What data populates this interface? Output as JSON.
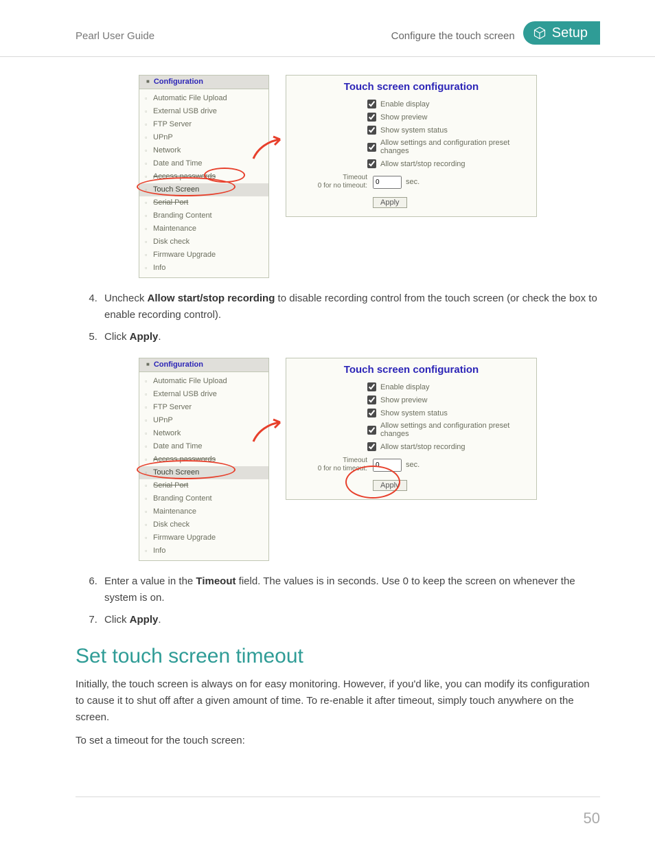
{
  "header": {
    "guide_title": "Pearl User Guide",
    "page_topic": "Configure the touch screen",
    "tab_label": "Setup"
  },
  "sidebar": {
    "title": "Configuration",
    "items": [
      {
        "label": "Automatic File Upload"
      },
      {
        "label": "External USB drive"
      },
      {
        "label": "FTP Server"
      },
      {
        "label": "UPnP"
      },
      {
        "label": "Network"
      },
      {
        "label": "Date and Time"
      },
      {
        "label": "Access passwords",
        "strike": true
      },
      {
        "label": "Touch Screen",
        "highlight": true
      },
      {
        "label": "Serial Port",
        "strike": true
      },
      {
        "label": "Branding Content"
      },
      {
        "label": "Maintenance"
      },
      {
        "label": "Disk check"
      },
      {
        "label": "Firmware Upgrade"
      },
      {
        "label": "Info"
      }
    ]
  },
  "panel": {
    "title": "Touch screen configuration",
    "checks": [
      {
        "label": "Enable display",
        "checked": true
      },
      {
        "label": "Show preview",
        "checked": true
      },
      {
        "label": "Show system status",
        "checked": true
      },
      {
        "label": "Allow settings and configuration preset changes",
        "checked": true
      },
      {
        "label": "Allow start/stop recording",
        "checked": true
      }
    ],
    "timeout_label_l1": "Timeout",
    "timeout_label_l2": "0 for no timeout:",
    "timeout_value": "0",
    "timeout_unit": "sec.",
    "apply_label": "Apply"
  },
  "steps_a": {
    "start": 4,
    "items": [
      {
        "pre": "Uncheck ",
        "bold": "Allow start/stop recording",
        "post": " to disable recording control from the touch screen (or check the box to enable recording control)."
      },
      {
        "pre": "Click ",
        "bold": "Apply",
        "post": "."
      }
    ]
  },
  "steps_b": {
    "start": 6,
    "items": [
      {
        "pre": "Enter a value in the ",
        "bold": "Timeout",
        "post": " field. The values is in seconds.  Use 0 to keep the screen on whenever the system is on."
      },
      {
        "pre": "Click ",
        "bold": "Apply",
        "post": "."
      }
    ]
  },
  "section_heading": "Set touch screen timeout",
  "body_p1": "Initially, the touch screen is always on for easy monitoring. However, if you'd like, you can modify its configuration to cause it to shut off after a given amount of time. To re-enable it after timeout, simply touch anywhere on the screen.",
  "body_p2": "To set a timeout for the touch screen:",
  "page_number": "50",
  "annot": {
    "circle1": {
      "mode": "nav-circle"
    },
    "circle2": {
      "mode": "allow-circle"
    },
    "circle3": {
      "mode": "apply-circle"
    }
  }
}
